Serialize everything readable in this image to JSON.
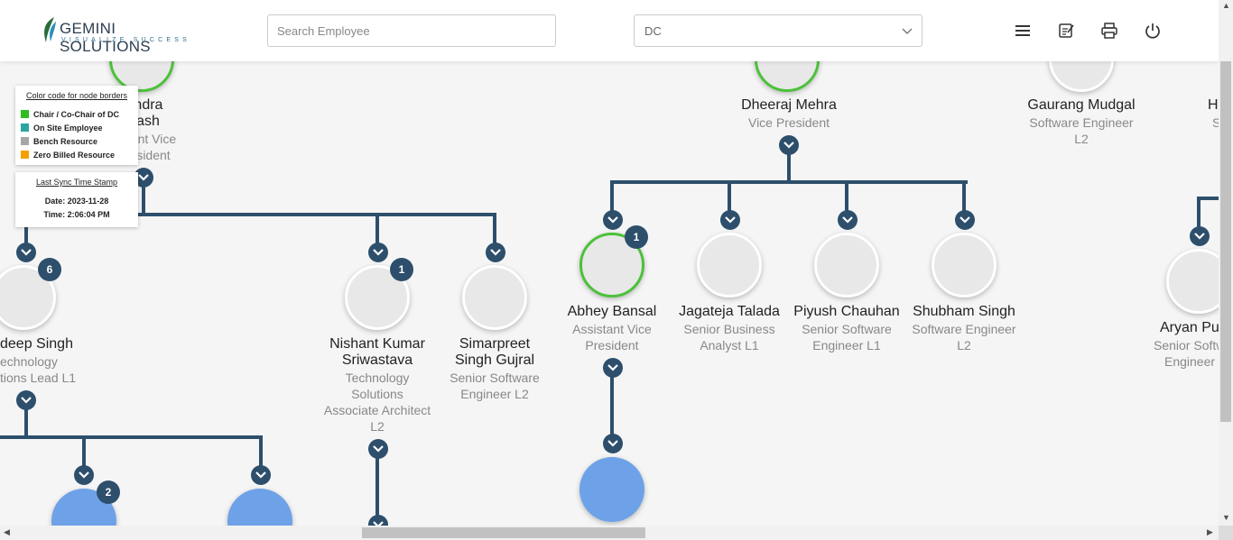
{
  "header": {
    "logo_main": "GEMINI SOLUTIONS",
    "logo_tagline": "VISUALIZE SUCCESS",
    "search_placeholder": "Search Employee",
    "dept_selected": "DC",
    "icons": [
      "menu-icon",
      "notes-icon",
      "print-icon",
      "power-icon"
    ]
  },
  "legend": {
    "heading": "Color code for node borders",
    "items": [
      {
        "label": "Chair / Co-Chair of DC",
        "color": "#2ebd1e"
      },
      {
        "label": "On Site Employee",
        "color": "#2ba5a0"
      },
      {
        "label": "Bench Resource",
        "color": "#a6a6a6"
      },
      {
        "label": "Zero Billed Resource",
        "color": "#f5a000"
      }
    ]
  },
  "sync": {
    "heading": "Last Sync Time Stamp",
    "date": "Date: 2023-11-28",
    "time": "Time: 2:06:04 PM"
  },
  "nodes": {
    "chandra": {
      "name_1": "andra",
      "name_2": "kash",
      "title_1": "ant Vice",
      "title_2": "sident"
    },
    "dheeraj": {
      "name": "Dheeraj Mehra",
      "title": "Vice President"
    },
    "gaurang": {
      "name": "Gaurang Mudgal",
      "title_1": "Software Engineer",
      "title_2": "L2"
    },
    "h_partial": {
      "name": "H",
      "title": "S"
    },
    "deep": {
      "badge": "6",
      "name": "deep Singh",
      "title_1": "echnology",
      "title_2": "tions Lead L1"
    },
    "nishant": {
      "badge": "1",
      "name_1": "Nishant Kumar",
      "name_2": "Sriwastava",
      "title_1": "Technology",
      "title_2": "Solutions",
      "title_3": "Associate Architect",
      "title_4": "L2"
    },
    "simarpreet": {
      "name_1": "Simarpreet",
      "name_2": "Singh Gujral",
      "title_1": "Senior Software",
      "title_2": "Engineer L2"
    },
    "abhey": {
      "badge": "1",
      "name": "Abhey Bansal",
      "title_1": "Assistant Vice",
      "title_2": "President"
    },
    "jagateja": {
      "name": "Jagateja Talada",
      "title_1": "Senior Business",
      "title_2": "Analyst L1"
    },
    "piyush": {
      "name": "Piyush Chauhan",
      "title_1": "Senior Software",
      "title_2": "Engineer L1"
    },
    "shubham": {
      "name": "Shubham Singh",
      "title_1": "Software Engineer",
      "title_2": "L2"
    },
    "aryan": {
      "name": "Aryan Pu",
      "title_1": "Senior Softw",
      "title_2": "Engineer"
    },
    "child_left_1": {
      "badge": "2"
    }
  }
}
